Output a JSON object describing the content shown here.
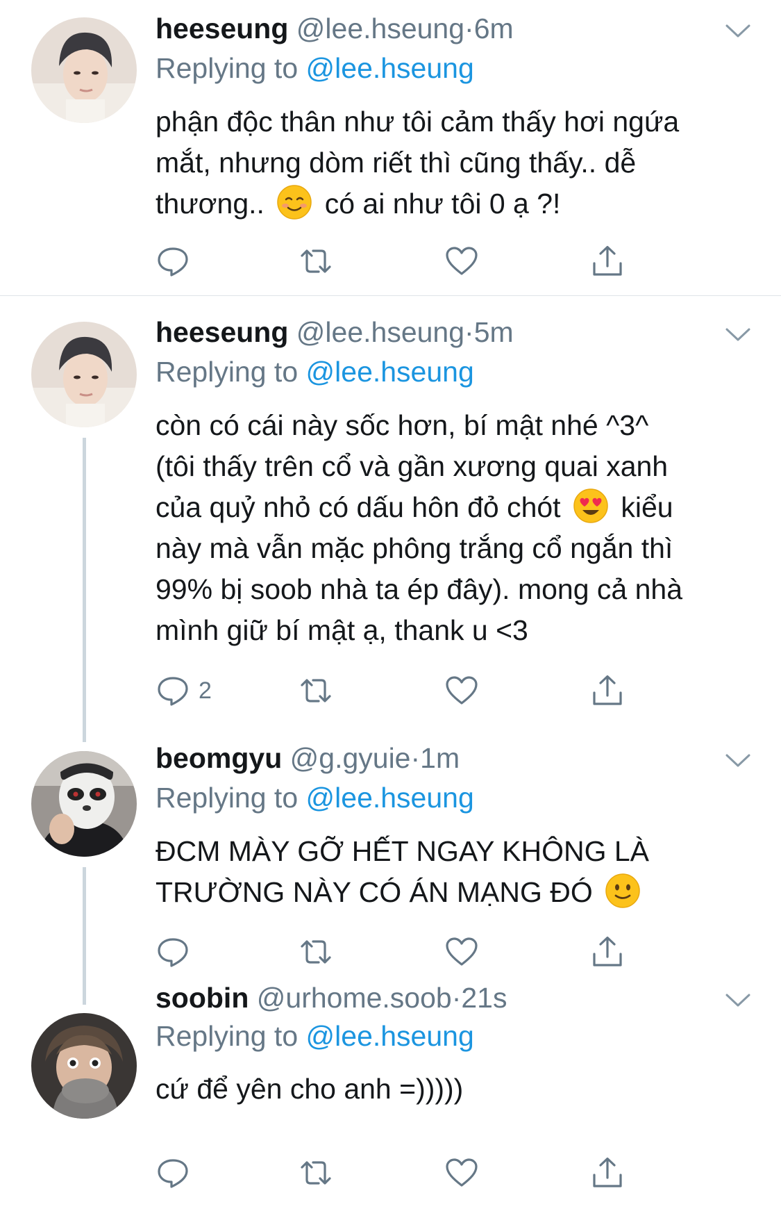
{
  "reply_prefix": "Replying to",
  "separator": "·",
  "tweets": [
    {
      "name": "heeseung",
      "handle": "@lee.hseung",
      "time": "6m",
      "replying_to": "@lee.hseung",
      "avatar": "avatar-heeseung",
      "lines": [
        {
          "pre": "phận độc thân như tôi cảm thấy hơi ngứa"
        },
        {
          "pre": "mắt, nhưng dòm riết thì cũng thấy.. dễ"
        },
        {
          "pre": "thương..",
          "emoji": "smiling-face-emoji",
          "post": "có ai như tôi 0 ạ ?!"
        }
      ],
      "reply_count": ""
    },
    {
      "name": "heeseung",
      "handle": "@lee.hseung",
      "time": "5m",
      "replying_to": "@lee.hseung",
      "avatar": "avatar-heeseung",
      "lines": [
        {
          "pre": "còn có cái này sốc hơn, bí mật nhé ^3^"
        },
        {
          "pre": "(tôi thấy trên cổ và gần xương quai xanh"
        },
        {
          "pre": "của quỷ nhỏ có dấu hôn đỏ chót",
          "emoji": "heart-eyes-emoji",
          "post": "kiểu"
        },
        {
          "pre": "này mà vẫn mặc phông trắng cổ ngắn thì"
        },
        {
          "pre": "99% bị soob nhà ta ép đây). mong cả nhà"
        },
        {
          "pre": "mình giữ bí mật ạ, thank u <3"
        }
      ],
      "reply_count": "2"
    },
    {
      "name": "beomgyu",
      "handle": "@g.gyuie",
      "time": "1m",
      "replying_to": "@lee.hseung",
      "avatar": "avatar-beomgyu",
      "lines": [
        {
          "pre": "ĐCM MÀY GỠ HẾT NGAY KHÔNG LÀ"
        },
        {
          "pre": "TRƯỜNG NÀY CÓ ÁN MẠNG ĐÓ",
          "emoji": "slight-smile-emoji",
          "post": ""
        }
      ],
      "reply_count": ""
    },
    {
      "name": "soobin",
      "handle": "@urhome.soob",
      "time": "21s",
      "replying_to": "@lee.hseung",
      "avatar": "avatar-soobin",
      "lines": [
        {
          "pre": "cứ để yên cho anh =)))))"
        }
      ],
      "reply_count": ""
    }
  ],
  "colors": {
    "text": "#14171a",
    "secondary": "#657786",
    "link": "#1b95e0",
    "divider": "#dfe3e8",
    "thread_line": "#ccd6dd"
  },
  "icons": [
    "reply-icon",
    "retweet-icon",
    "like-icon",
    "share-icon",
    "chevron-down-icon"
  ]
}
